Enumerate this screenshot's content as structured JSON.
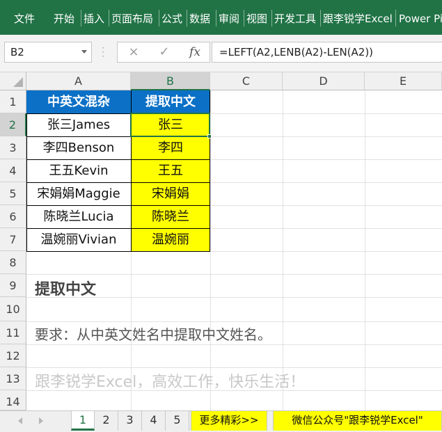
{
  "ribbon": {
    "tabs": [
      "文件",
      "开始",
      "插入",
      "页面布局",
      "公式",
      "数据",
      "审阅",
      "视图",
      "开发工具",
      "跟李锐学Excel",
      "Power Pi"
    ]
  },
  "formula_bar": {
    "name_box": "B2",
    "cancel_icon": "×",
    "enter_icon": "✓",
    "fx_label": "fx",
    "formula": "=LEFT(A2,LENB(A2)-LEN(A2))"
  },
  "columns": [
    "A",
    "B",
    "C",
    "D",
    "E"
  ],
  "rows": [
    "1",
    "2",
    "3",
    "4",
    "5",
    "6",
    "7",
    "8",
    "9",
    "10",
    "11",
    "12",
    "13",
    "14"
  ],
  "table": {
    "header": [
      "中英文混杂",
      "提取中文"
    ],
    "data": [
      [
        "张三James",
        "张三"
      ],
      [
        "李四Benson",
        "李四"
      ],
      [
        "王五Kevin",
        "王五"
      ],
      [
        "宋娟娟Maggie",
        "宋娟娟"
      ],
      [
        "陈晓兰Lucia",
        "陈晓兰"
      ],
      [
        "温婉丽Vivian",
        "温婉丽"
      ]
    ]
  },
  "notes": {
    "title": "提取中文",
    "requirement": "要求：从中英文姓名中提取中文姓名。",
    "slogan": "跟李锐学Excel，高效工作，快乐生活！"
  },
  "sheet_tabs": {
    "numbers": [
      "1",
      "2",
      "3",
      "4",
      "5"
    ],
    "active": "1",
    "more": "更多精彩>>",
    "wechat": "微信公众号\"跟李锐学Excel\""
  },
  "colors": {
    "ribbon": "#217346",
    "header_fill": "#0b70c6",
    "highlight_fill": "#ffff00",
    "selection": "#217346"
  }
}
